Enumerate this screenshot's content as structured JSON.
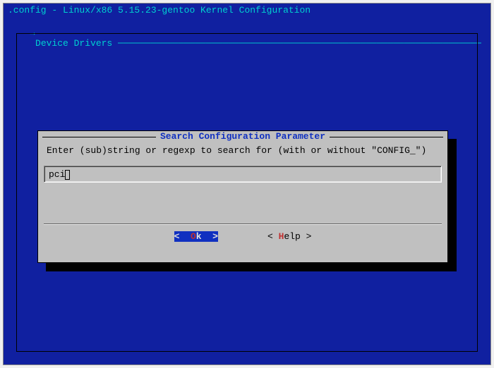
{
  "header": {
    "title": ".config - Linux/x86 5.15.23-gentoo Kernel Configuration",
    "breadcrumb": "→ Device Drivers"
  },
  "dialog": {
    "title": "Search Configuration Parameter",
    "instruction": "Enter (sub)string or regexp to search for (with or without \"CONFIG_\")",
    "input_value": "pci",
    "buttons": {
      "ok": {
        "left": "<  ",
        "hotkey": "O",
        "rest": "k  >"
      },
      "help": {
        "left": "< ",
        "hotkey": "H",
        "rest": "elp >"
      }
    }
  }
}
